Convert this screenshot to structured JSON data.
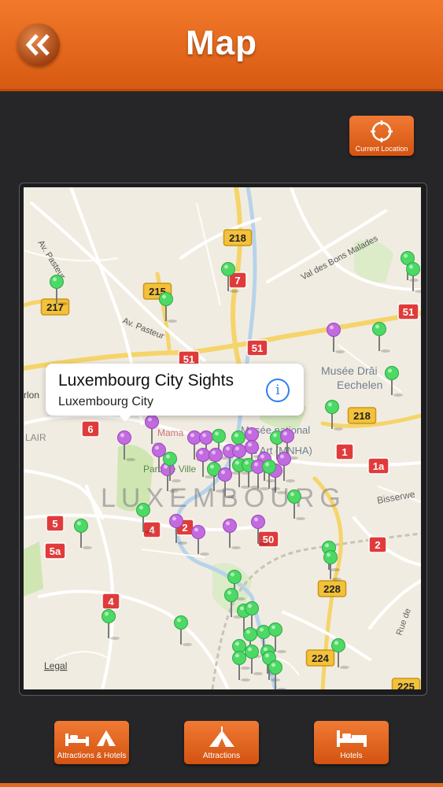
{
  "header": {
    "title": "Map"
  },
  "current_location": {
    "label": "Current Location"
  },
  "map": {
    "callout": {
      "title": "Luxembourg City Sights",
      "subtitle": "Luxembourg City"
    },
    "city_label": "LUXEMBOURG",
    "streets": [
      "Av. Pasteur",
      "Av. Pasteur",
      "Val des Bons Malades",
      "Bisserwe",
      "Rue de"
    ],
    "places": [
      "Musée Drâi",
      "Eechelen",
      "Musée national",
      "d'Art (MNHA)",
      "Parc de Ville",
      "Mama",
      "LAIR",
      "rlon",
      "Legal"
    ],
    "road_labels": [
      "218",
      "215",
      "217",
      "51",
      "51",
      "51",
      "218",
      "228",
      "224",
      "225",
      "7",
      "6",
      "5",
      "5a",
      "4",
      "4",
      "2",
      "2",
      "50",
      "1",
      "1a"
    ]
  },
  "tabs": [
    {
      "label": "Attractions & Hotels",
      "icon": "bed-and-tent-icon"
    },
    {
      "label": "Attractions",
      "icon": "tent-icon"
    },
    {
      "label": "Hotels",
      "icon": "bed-icon"
    }
  ],
  "colors": {
    "accent": "#e8692a",
    "pin_green": "#4cd964",
    "pin_purple": "#c26be0"
  }
}
